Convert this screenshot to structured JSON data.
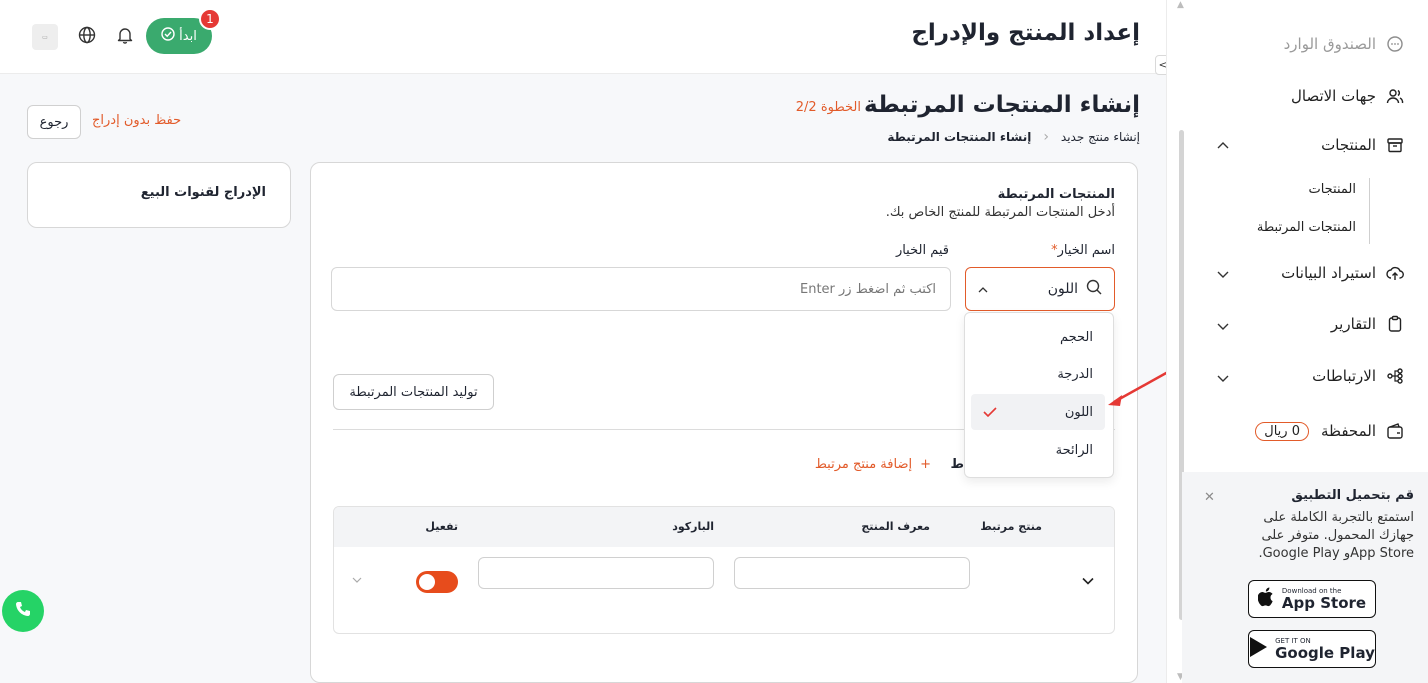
{
  "header": {
    "title": "إعداد المنتج والإدراج",
    "start_label": "ابدأ",
    "start_badge": "1"
  },
  "page": {
    "title": "إنشاء المنتجات المرتبطة",
    "step": "الخطوة 2/2",
    "breadcrumb": [
      "إنشاء منتج جديد",
      "إنشاء المنتجات المرتبطة"
    ],
    "back_label": "رجوع",
    "save_label": "حفظ بدون إدراج",
    "listing_card_title": "الإدراج لقنوات البيع"
  },
  "form": {
    "section_title": "المنتجات المرتبطة",
    "section_desc": "أدخل المنتجات المرتبطة للمنتج الخاص بك.",
    "option_name_label": "اسم الخيار",
    "option_name_required": "*",
    "option_values_label": "قيم الخيار",
    "selected_option": "اللون",
    "values_placeholder": "اكتب ثم اضغط زر Enter",
    "generate_label": "توليد المنتجات المرتبطة",
    "add_link_label": "إضافة منتج مرتبط",
    "partial_text": "ط",
    "dropdown_options": [
      "الحجم",
      "الدرجة",
      "اللون",
      "الرائحة"
    ],
    "dropdown_selected_index": 2
  },
  "table": {
    "headers": [
      "منتج مرتبط",
      "معرف المنتج",
      "الباركود",
      "تفعيل"
    ],
    "row_toggle_on": true
  },
  "sidebar": {
    "items": [
      {
        "label": "الصندوق الوارد",
        "icon": "chat-bubble-icon"
      },
      {
        "label": "جهات الاتصال",
        "icon": "contacts-icon"
      },
      {
        "label": "المنتجات",
        "icon": "box-icon"
      },
      {
        "label": "استيراد البيانات",
        "icon": "cloud-upload-icon"
      },
      {
        "label": "التقارير",
        "icon": "clipboard-icon"
      },
      {
        "label": "الارتباطات",
        "icon": "integrations-icon"
      },
      {
        "label": "المحفظة",
        "icon": "wallet-icon"
      }
    ],
    "sub_items": [
      "المنتجات",
      "المنتجات المرتبطة"
    ],
    "wallet_balance": "0 ريال"
  },
  "app_card": {
    "title": "قم بتحميل التطبيق",
    "desc": "استمتع بالتجربة الكاملة على جهازك المحمول. متوفر على App Storeو Google Play.",
    "appstore_small": "Download on the",
    "appstore_big": "App Store",
    "gplay_small": "GET IT ON",
    "gplay_big": "Google Play"
  },
  "colors": {
    "accent": "#e25b2a",
    "start_green": "#3aaa6e",
    "toggle": "#e74c1c"
  }
}
